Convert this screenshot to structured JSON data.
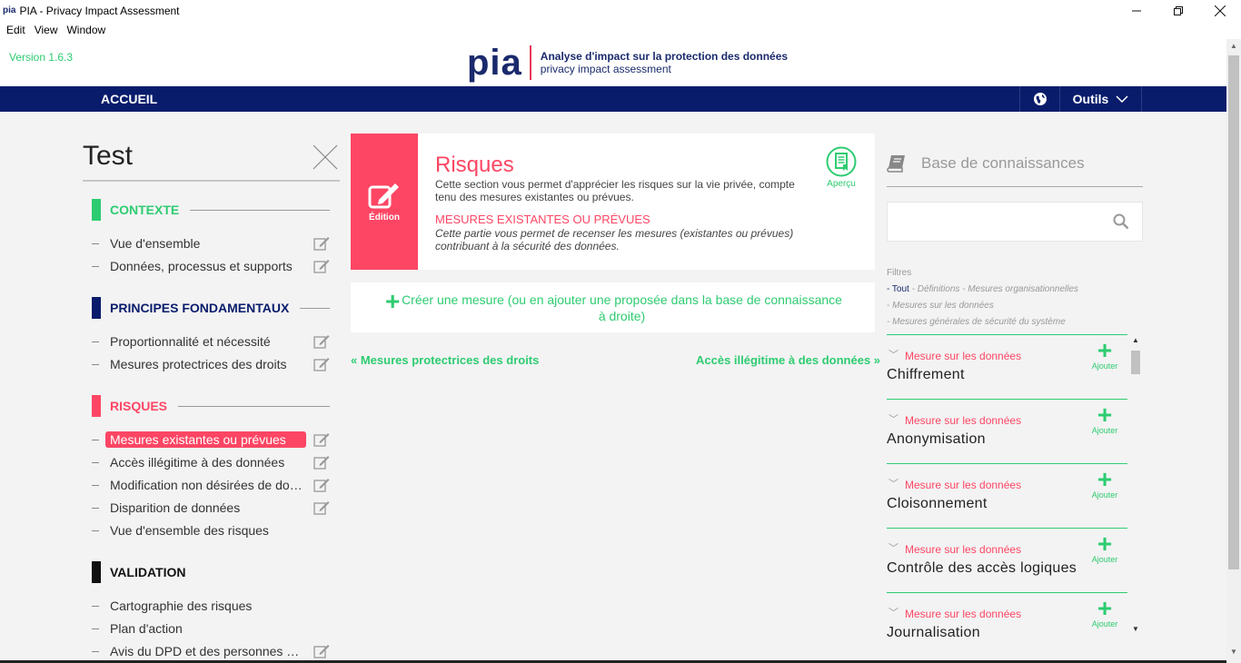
{
  "window": {
    "title": "PIA - Privacy Impact Assessment",
    "app_icon": "pia"
  },
  "menu": [
    "Edit",
    "View",
    "Window"
  ],
  "header": {
    "version": "Version 1.6.3",
    "logo_text": "pia",
    "logo_line1": "Analyse d'impact sur la protection des données",
    "logo_line2": "privacy impact assessment"
  },
  "nav": {
    "home": "ACCUEIL",
    "tools": "Outils"
  },
  "pia_name": "Test",
  "sidebar": {
    "sections": [
      {
        "label": "CONTEXTE",
        "color": "#2ecc71",
        "items": [
          {
            "label": "Vue d'ensemble",
            "edit": true
          },
          {
            "label": "Données, processus et supports",
            "edit": true
          }
        ]
      },
      {
        "label": "PRINCIPES FONDAMENTAUX",
        "color": "#091c6b",
        "items": [
          {
            "label": "Proportionnalité et nécessité",
            "edit": true
          },
          {
            "label": "Mesures protectrices des droits",
            "edit": true
          }
        ]
      },
      {
        "label": "RISQUES",
        "color": "#fd4664",
        "items": [
          {
            "label": "Mesures existantes ou prévues",
            "edit": true,
            "active": true
          },
          {
            "label": "Accès illégitime à des données",
            "edit": true
          },
          {
            "label": "Modification non désirées de données",
            "edit": true
          },
          {
            "label": "Disparition de données",
            "edit": true
          },
          {
            "label": "Vue d'ensemble des risques",
            "edit": false
          }
        ]
      },
      {
        "label": "VALIDATION",
        "color": "#111111",
        "items": [
          {
            "label": "Cartographie des risques",
            "edit": false
          },
          {
            "label": "Plan d'action",
            "edit": false
          },
          {
            "label": "Avis du DPD et des personnes concernées",
            "edit": true
          }
        ]
      }
    ]
  },
  "risk_card": {
    "edit_label": "Édition",
    "title": "Risques",
    "description": "Cette section vous permet d'apprécier les risques sur la vie privée, compte tenu des mesures existantes ou prévues.",
    "subtitle": "MESURES EXISTANTES OU PRÉVUES",
    "subdescription": "Cette partie vous permet de recenser les mesures (existantes ou prévues) contribuant à la sécurité des données.",
    "preview_label": "Aperçu"
  },
  "create_measure": "Créer une mesure (ou en ajouter une proposée dans la base de connaissance à droite)",
  "prev_link": "« Mesures protectrices des droits",
  "next_link": "Accès illégitime à des données »",
  "knowledge_base": {
    "title": "Base de connaissances",
    "search_placeholder": "",
    "filters_label": "Filtres",
    "filter_all": "- Tout",
    "filter_line1": " - Définitions - Mesures organisationnelles",
    "filter_line2": "- Mesures sur les données",
    "filter_line3": "- Mesures générales de sécurité du système",
    "add_label": "Ajouter",
    "items": [
      {
        "category": "Mesure sur les données",
        "name": "Chiffrement"
      },
      {
        "category": "Mesure sur les données",
        "name": "Anonymisation"
      },
      {
        "category": "Mesure sur les données",
        "name": "Cloisonnement"
      },
      {
        "category": "Mesure sur les données",
        "name": "Contrôle des accès logiques"
      },
      {
        "category": "Mesure sur les données",
        "name": "Journalisation"
      }
    ]
  },
  "colors": {
    "green": "#2ecc71",
    "red": "#fd4664",
    "navy": "#091c6b"
  }
}
